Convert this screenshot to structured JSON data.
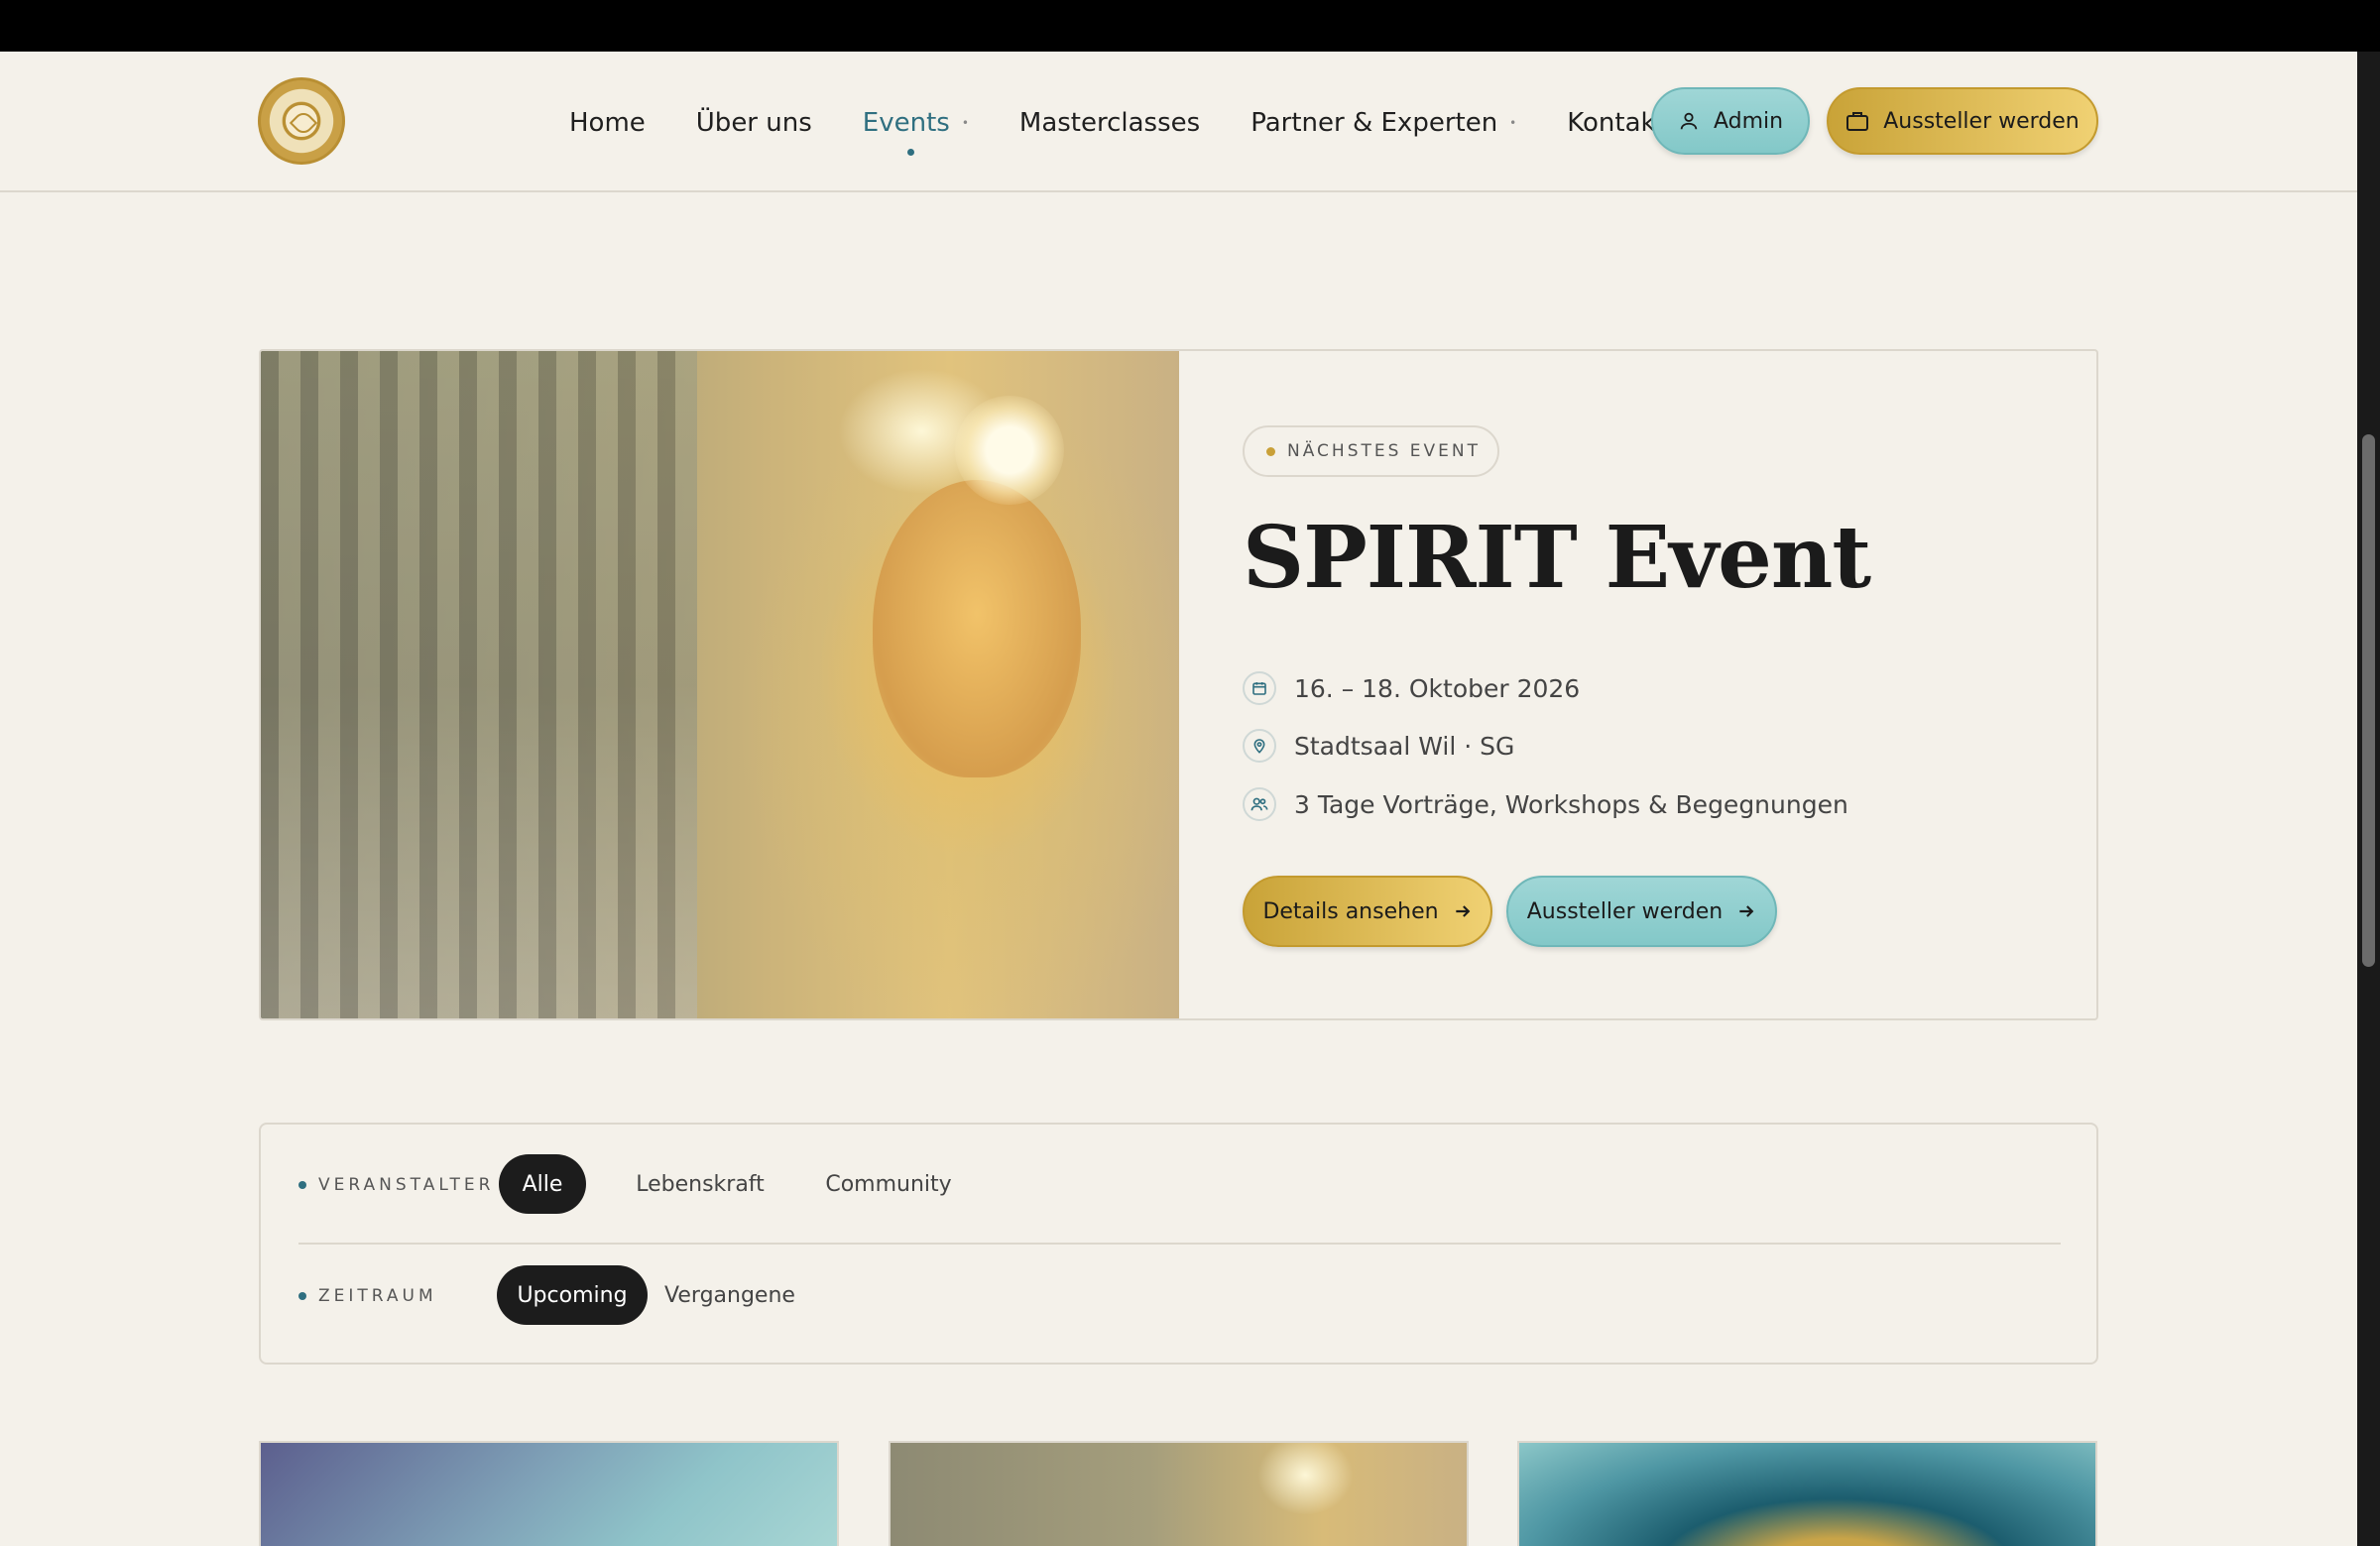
{
  "header": {
    "nav": [
      {
        "label": "Home",
        "active": false,
        "has_dropdown": false
      },
      {
        "label": "Über uns",
        "active": false,
        "has_dropdown": false
      },
      {
        "label": "Events",
        "active": true,
        "has_dropdown": true
      },
      {
        "label": "Masterclasses",
        "active": false,
        "has_dropdown": false
      },
      {
        "label": "Partner & Experten",
        "active": false,
        "has_dropdown": true
      },
      {
        "label": "Kontakt",
        "active": false,
        "has_dropdown": false
      }
    ],
    "admin_label": "Admin",
    "exhibitor_label": "Aussteller werden"
  },
  "hero": {
    "tag": "NÄCHSTES EVENT",
    "title": "SPIRIT Event",
    "date": "16. – 18. Oktober 2026",
    "location": "Stadtsaal Wil · SG",
    "program": "3 Tage Vorträge, Workshops & Begegnungen",
    "details_label": "Details ansehen",
    "exhibitor_label": "Aussteller werden"
  },
  "filters": {
    "organizer": {
      "label": "VERANSTALTER",
      "options": [
        "Alle",
        "Lebenskraft",
        "Community"
      ],
      "selected": "Alle"
    },
    "period": {
      "label": "ZEITRAUM",
      "options": [
        "Upcoming",
        "Vergangene"
      ],
      "selected": "Upcoming"
    }
  },
  "colors": {
    "accent_teal": "#2f6f80",
    "gold": "#c9a038",
    "background": "#f4f1ea",
    "dark_chip": "#1c1c1c"
  },
  "icons": {
    "admin": "user-icon",
    "exhibitor": "briefcase-icon",
    "date": "calendar-icon",
    "location": "map-pin-icon",
    "program": "users-icon",
    "button_arrow": "arrow-right-icon"
  }
}
